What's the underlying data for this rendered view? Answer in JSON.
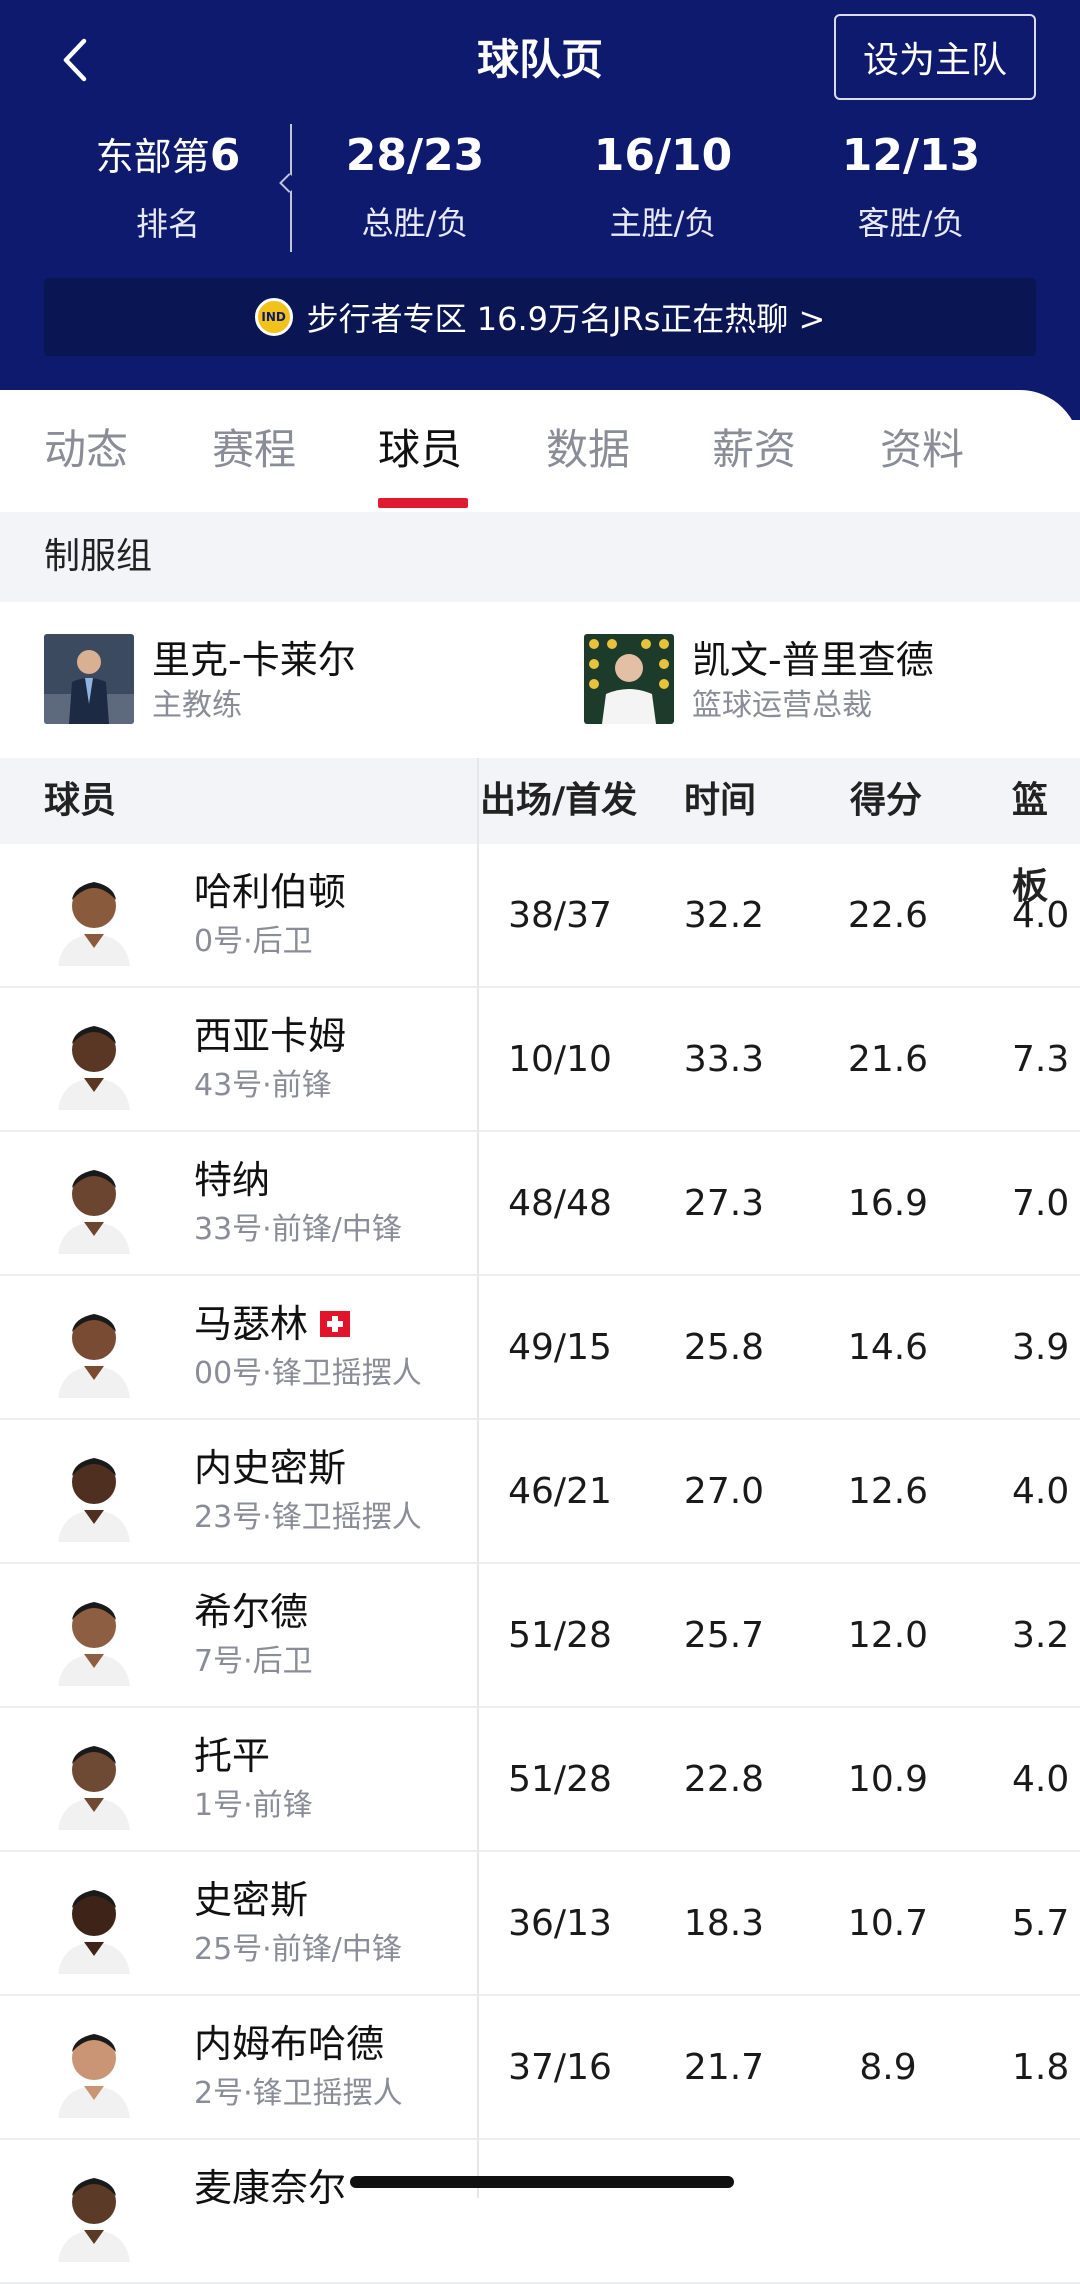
{
  "header": {
    "title": "球队页",
    "set_home_label": "设为主队",
    "rank_prefix": "东部第",
    "rank_value": "6",
    "rank_label": "排名",
    "stats": [
      {
        "value": "28/23",
        "label": "总胜/负"
      },
      {
        "value": "16/10",
        "label": "主胜/负"
      },
      {
        "value": "12/13",
        "label": "客胜/负"
      }
    ],
    "banner_text": "步行者专区 16.9万名JRs正在热聊 >",
    "logo_text": "IND"
  },
  "tabs": [
    "动态",
    "赛程",
    "球员",
    "数据",
    "薪资",
    "资料"
  ],
  "active_tab": "球员",
  "staff_section": {
    "title": "制服组",
    "members": [
      {
        "name": "里克-卡莱尔",
        "role": "主教练"
      },
      {
        "name": "凯文-普里查德",
        "role": "篮球运营总裁"
      }
    ]
  },
  "table": {
    "headers": [
      "球员",
      "出场/首发",
      "时间",
      "得分",
      "篮板"
    ],
    "rows": [
      {
        "name": "哈利伯顿",
        "meta": "0号·后卫",
        "gp": "38/37",
        "min": "32.2",
        "pts": "22.6",
        "reb": "4.0"
      },
      {
        "name": "西亚卡姆",
        "meta": "43号·前锋",
        "gp": "10/10",
        "min": "33.3",
        "pts": "21.6",
        "reb": "7.3"
      },
      {
        "name": "特纳",
        "meta": "33号·前锋/中锋",
        "gp": "48/48",
        "min": "27.3",
        "pts": "16.9",
        "reb": "7.0"
      },
      {
        "name": "马瑟林",
        "meta": "00号·锋卫摇摆人",
        "gp": "49/15",
        "min": "25.8",
        "pts": "14.6",
        "reb": "3.9",
        "flag": true
      },
      {
        "name": "内史密斯",
        "meta": "23号·锋卫摇摆人",
        "gp": "46/21",
        "min": "27.0",
        "pts": "12.6",
        "reb": "4.0"
      },
      {
        "name": "希尔德",
        "meta": "7号·后卫",
        "gp": "51/28",
        "min": "25.7",
        "pts": "12.0",
        "reb": "3.2"
      },
      {
        "name": "托平",
        "meta": "1号·前锋",
        "gp": "51/28",
        "min": "22.8",
        "pts": "10.9",
        "reb": "4.0"
      },
      {
        "name": "史密斯",
        "meta": "25号·前锋/中锋",
        "gp": "36/13",
        "min": "18.3",
        "pts": "10.7",
        "reb": "5.7"
      },
      {
        "name": "内姆布哈德",
        "meta": "2号·锋卫摇摆人",
        "gp": "37/16",
        "min": "21.7",
        "pts": "8.9",
        "reb": "1.8"
      },
      {
        "name": "麦康奈尔",
        "meta": "",
        "gp": "",
        "min": "",
        "pts": "",
        "reb": ""
      }
    ]
  },
  "colors": {
    "header_bg": "#0d1a6e",
    "accent": "#e01b2f",
    "muted": "#8a8d97"
  }
}
